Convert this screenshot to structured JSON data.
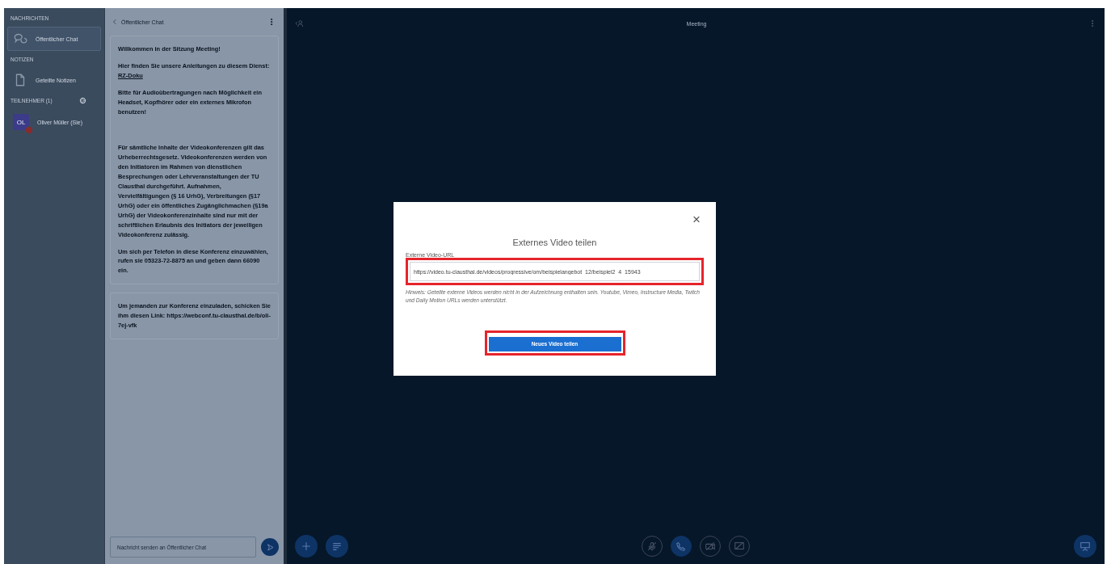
{
  "sidebar": {
    "sections": [
      {
        "title": "NACHRICHTEN",
        "items": [
          {
            "kind": "chat",
            "label": "Öffentlicher Chat",
            "selected": true
          }
        ]
      },
      {
        "title": "NOTIZEN",
        "items": [
          {
            "kind": "notes",
            "label": "Geteilte Notizen",
            "selected": false
          }
        ]
      },
      {
        "title": "TEILNEHMER (1)",
        "settings": true,
        "items": [
          {
            "kind": "user",
            "label": "Oliver Müller (Sie)",
            "initials": "OL",
            "selected": false
          }
        ]
      }
    ]
  },
  "chat": {
    "title": "Öffentlicher Chat",
    "messages": [
      {
        "paragraphs": [
          {
            "text": "Willkommen in der Sitzung **Meeting**!"
          },
          {
            "text": "Hier finden Sie unsere Anleitungen zu diesem Dienst: ",
            "link": "RZ-Doku"
          },
          {
            "text": "Bitte für Audioübertragungen nach Möglichkeit ein Headset, Kopfhörer oder ein externes Mikrofon benutzen!"
          },
          {
            "text": "Für sämtliche Inhalte der Videokonferenzen gilt das Urheberrechtsgesetz. Videokonferenzen werden von den Initiatoren im Rahmen von dienstlichen Besprechungen oder Lehrveranstaltungen der TU Clausthal durchgeführt. Aufnahmen, Vervielfältigungen (§ 16 UrhG), Verbreitungen (§17 UrhG) oder ein öffentliches Zugänglichmachen (§19a UrhG) der Videokonferenzinhalte sind nur mit der schriftlichen Erlaubnis des Initiators der jeweiligen Videokonferenz zulässig.",
            "gap": true
          },
          {
            "text": "Um sich per Telefon in diese Konferenz einzuwählen, rufen sie 05323-72-8875 an und geben dann 66090 ein."
          }
        ]
      },
      {
        "paragraphs": [
          {
            "text": "Um jemanden zur Konferenz einzuladen, schicken Sie ihm diesen Link: https://webconf.tu-clausthal.de/b/oli-7ej-vfk"
          }
        ]
      }
    ],
    "input": {
      "placeholder": "Nachricht senden an Öffentlicher Chat"
    }
  },
  "main": {
    "title": "Meeting",
    "controls": [
      {
        "kind": "mic",
        "active": false
      },
      {
        "kind": "phone",
        "active": true
      },
      {
        "kind": "camera",
        "active": false
      },
      {
        "kind": "screen",
        "active": false
      }
    ]
  },
  "modal": {
    "title": "Externes Video teilen",
    "field_label": "Externe Video-URL",
    "value": "https://video.tu-clausthal.de/videos/progressive/om/beispielangebot_12/beispiel2_4_15943",
    "hint": "Hinweis: Geteilte externe Videos werden nicht in der Aufzeichnung enthalten sein. Youtube, Vimeo, Instructure Media, Twitch und Daily Motion URLs werden unterstützt.",
    "button": "Neues Video teilen",
    "close": "×"
  }
}
